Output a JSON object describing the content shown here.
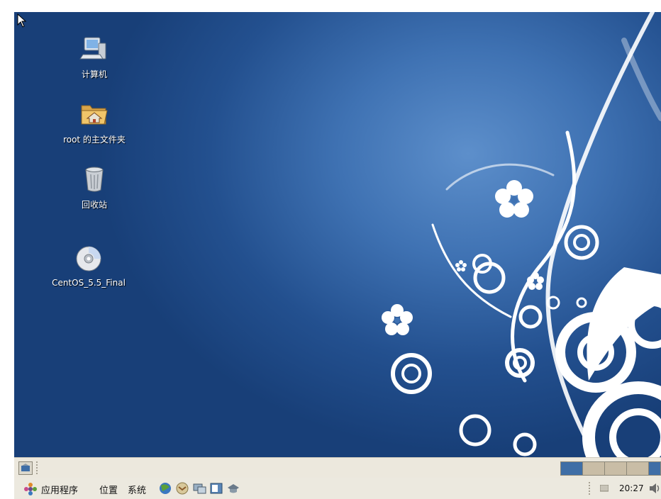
{
  "desktop": {
    "icons": [
      {
        "label": "计算机",
        "icon": "computer-icon"
      },
      {
        "label": "root 的主文件夹",
        "icon": "home-folder-icon"
      },
      {
        "label": "回收站",
        "icon": "trash-icon"
      },
      {
        "label": "CentOS_5.5_Final",
        "icon": "cdrom-icon"
      }
    ]
  },
  "top_panel": {
    "menus": [
      "应用程序",
      "位置",
      "系统"
    ],
    "launchers": [
      "browser-icon",
      "mail-icon",
      "network-icon",
      "notes-icon",
      "update-icon"
    ],
    "clock": "20:27",
    "tray_icons": [
      "network-tray-icon",
      "volume-icon"
    ]
  },
  "bottom_panel": {
    "show_desktop_icon": "show-desktop-icon",
    "workspaces": 4,
    "active_workspace": 1
  },
  "colors": {
    "desktop_bg": "#23508f",
    "panel_bg": "#ece9df",
    "workspace_active": "#3f6ea6",
    "workspace_inactive": "#c9bda6"
  }
}
